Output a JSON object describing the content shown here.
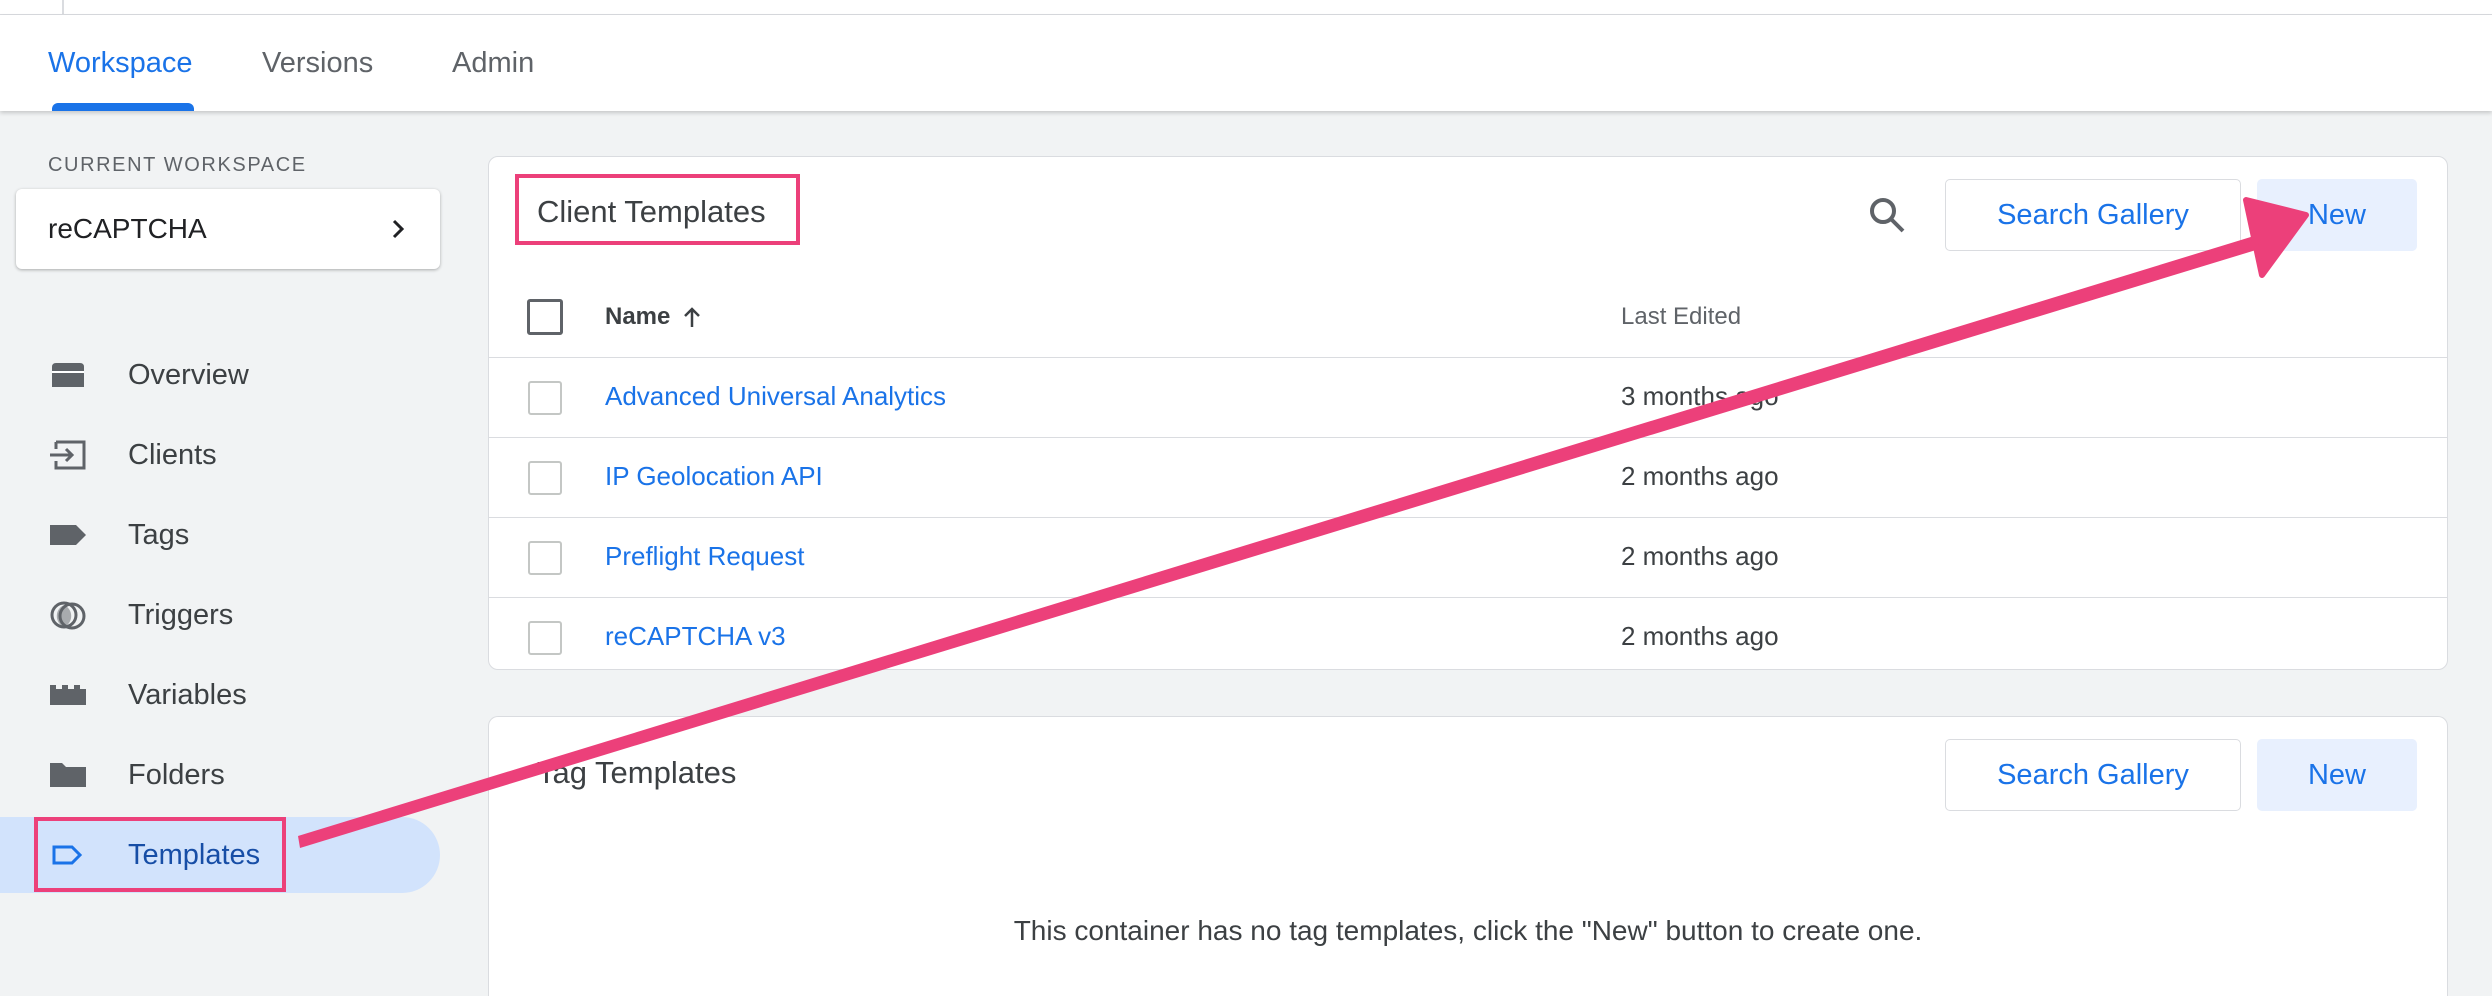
{
  "tabs": [
    "Workspace",
    "Versions",
    "Admin"
  ],
  "sidebar": {
    "current_workspace_label": "CURRENT WORKSPACE",
    "workspace_name": "reCAPTCHA",
    "items": [
      {
        "label": "Overview",
        "icon": "overview-icon"
      },
      {
        "label": "Clients",
        "icon": "clients-icon"
      },
      {
        "label": "Tags",
        "icon": "tag-icon"
      },
      {
        "label": "Triggers",
        "icon": "triggers-icon"
      },
      {
        "label": "Variables",
        "icon": "variables-icon"
      },
      {
        "label": "Folders",
        "icon": "folder-icon"
      },
      {
        "label": "Templates",
        "icon": "templates-icon",
        "active": true
      }
    ]
  },
  "client_templates": {
    "title": "Client Templates",
    "search_gallery_label": "Search Gallery",
    "new_label": "New",
    "columns": {
      "name": "Name",
      "last_edited": "Last Edited"
    },
    "rows": [
      {
        "name": "Advanced Universal Analytics",
        "edited": "3 months ago"
      },
      {
        "name": "IP Geolocation API",
        "edited": "2 months ago"
      },
      {
        "name": "Preflight Request",
        "edited": "2 months ago"
      },
      {
        "name": "reCAPTCHA v3",
        "edited": "2 months ago"
      }
    ]
  },
  "tag_templates": {
    "title": "Tag Templates",
    "search_gallery_label": "Search Gallery",
    "new_label": "New",
    "empty_message": "This container has no tag templates, click the \"New\" button to create one."
  },
  "colors": {
    "accent": "#1a73e8",
    "annotation": "#ec407a",
    "active_nav_bg": "#d2e3fc"
  }
}
